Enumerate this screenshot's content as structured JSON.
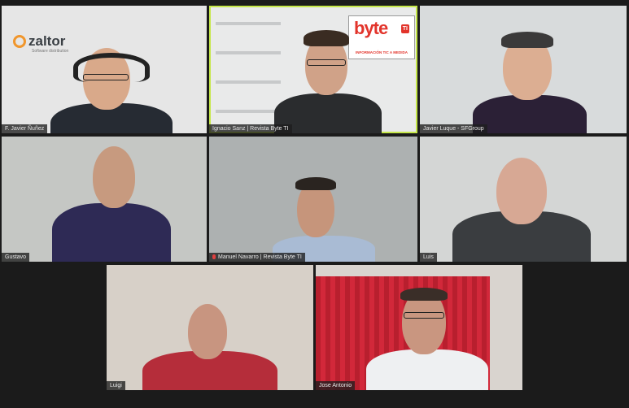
{
  "tiles": [
    {
      "name": "F. Javier Ñuñez",
      "logo": {
        "text": "zaltor",
        "sub": "Software distribution"
      }
    },
    {
      "name": "Ignacio Sanz | Revista Byte TI",
      "banner": {
        "brand": "byte",
        "badge": "TI",
        "tagline": "INFORMACIÓN TIC A MEDIDA"
      }
    },
    {
      "name": "Javier Luque - SFGroup"
    },
    {
      "name": "Gustavo"
    },
    {
      "name": "Manuel Navarro | Revista Byte TI"
    },
    {
      "name": "Luis"
    },
    {
      "name": "Luigi"
    },
    {
      "name": "Jose Antonio"
    }
  ],
  "colors": {
    "active_speaker_border": "#c6e84a",
    "brand_red": "#e2342b",
    "logo_orange": "#f0962c"
  },
  "icons": {
    "muted_mic": "mic-muted-icon",
    "zaltor_logo": "zaltor-logo-icon"
  }
}
